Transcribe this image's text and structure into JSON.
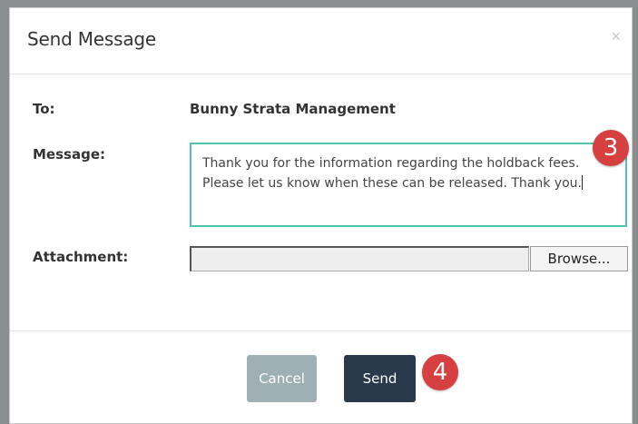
{
  "dialog": {
    "title": "Send Message",
    "close_symbol": "×"
  },
  "form": {
    "to_label": "To:",
    "to_value": "Bunny Strata Management",
    "message_label": "Message:",
    "message_lines": [
      "Thank you for the information regarding the holdback fees.",
      "Please let us know when these can be released.  Thank you."
    ],
    "attachment_label": "Attachment:",
    "browse_label": "Browse..."
  },
  "buttons": {
    "cancel_label": "Cancel",
    "send_label": "Send"
  },
  "annotations": {
    "step_message": "3",
    "step_send": "4"
  },
  "colors": {
    "textarea_focus": "#4ec4ae",
    "send_button": "#2a3a4c",
    "cancel_button": "#9eb0b4",
    "step_badge": "#d64040"
  }
}
